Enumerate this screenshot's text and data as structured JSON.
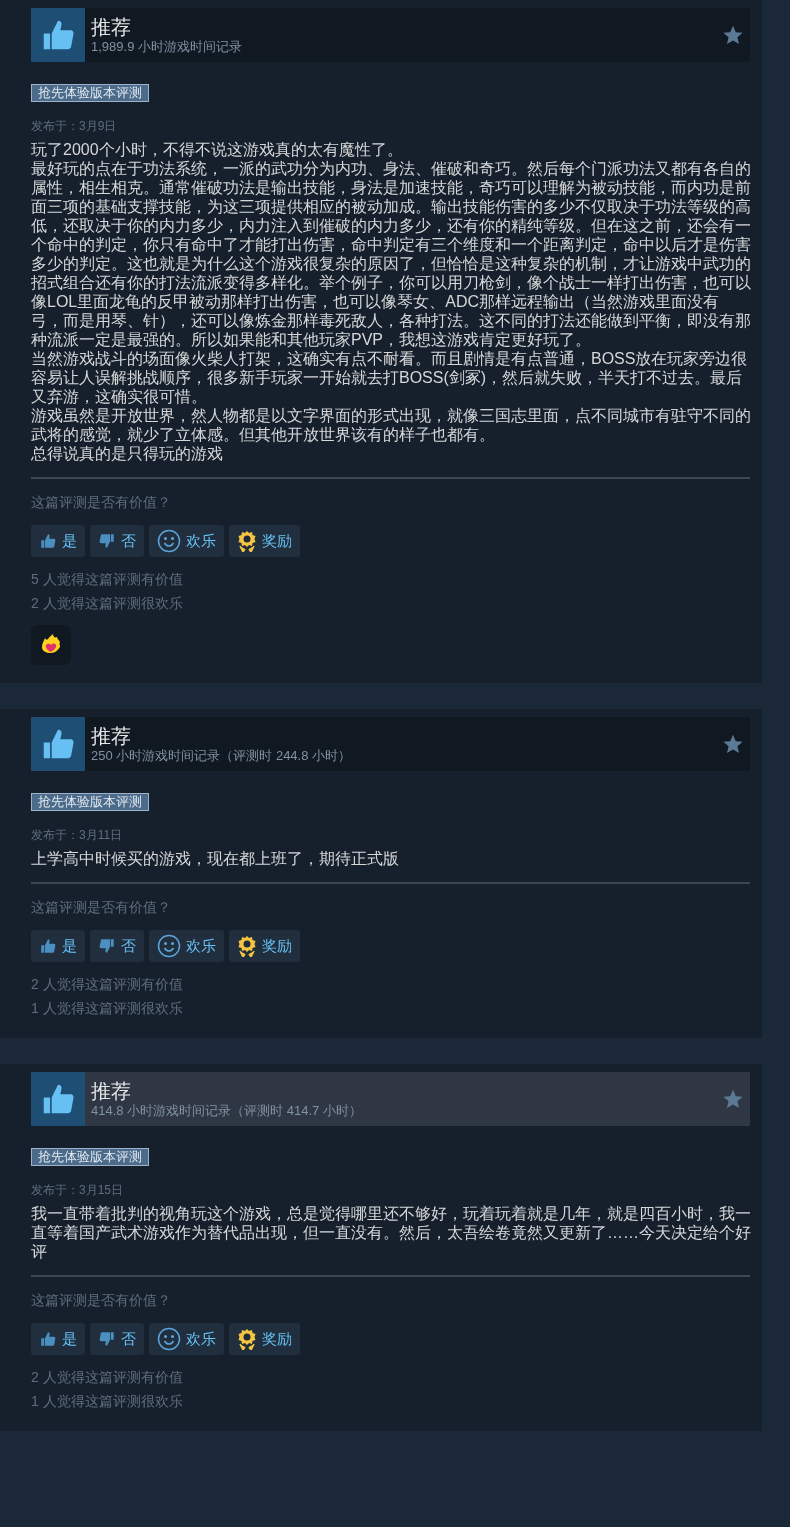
{
  "reviews": [
    {
      "recommendation": "推荐",
      "playtime": "1,989.9 小时游戏时间记录",
      "highlighted": false,
      "tag": "抢先体验版本评测",
      "date": "发布于：3月9日",
      "paragraphs": [
        "玩了2000个小时，不得不说这游戏真的太有魔性了。",
        "最好玩的点在于功法系统，一派的武功分为内功、身法、催破和奇巧。然后每个门派功法又都有各自的属性，相生相克。通常催破功法是输出技能，身法是加速技能，奇巧可以理解为被动技能，而内功是前面三项的基础支撑技能，为这三项提供相应的被动加成。输出技能伤害的多少不仅取决于功法等级的高低，还取决于你的内力多少，内力注入到催破的内力多少，还有你的精纯等级。但在这之前，还会有一个命中的判定，你只有命中了才能打出伤害，命中判定有三个维度和一个距离判定，命中以后才是伤害多少的判定。这也就是为什么这个游戏很复杂的原因了，但恰恰是这种复杂的机制，才让游戏中武功的招式组合还有你的打法流派变得多样化。举个例子，你可以用刀枪剑，像个战士一样打出伤害，也可以像LOL里面龙龟的反甲被动那样打出伤害，也可以像琴女、ADC那样远程输出（当然游戏里面没有弓，而是用琴、针），还可以像炼金那样毒死敌人，各种打法。这不同的打法还能做到平衡，即没有那种流派一定是最强的。所以如果能和其他玩家PVP，我想这游戏肯定更好玩了。",
        "当然游戏战斗的场面像火柴人打架，这确实有点不耐看。而且剧情是有点普通，BOSS放在玩家旁边很容易让人误解挑战顺序，很多新手玩家一开始就去打BOSS(剑冢)，然后就失败，半天打不过去。最后又弃游，这确实很可惜。",
        "游戏虽然是开放世界，然人物都是以文字界面的形式出现，就像三国志里面，点不同城市有驻守不同的武将的感觉，就少了立体感。但其他开放世界该有的样子也都有。",
        "总得说真的是只得玩的游戏"
      ],
      "question": "这篇评测是否有价值？",
      "buttons": [
        {
          "kind": "yes",
          "label": "是"
        },
        {
          "kind": "no",
          "label": "否"
        },
        {
          "kind": "funny",
          "label": "欢乐"
        },
        {
          "kind": "award",
          "label": "奖励"
        }
      ],
      "counts": [
        "5 人觉得这篇评测有价值",
        "2 人觉得这篇评测很欢乐"
      ],
      "award_badges": [
        {
          "kind": "flame-heart"
        }
      ]
    },
    {
      "recommendation": "推荐",
      "playtime": "250 小时游戏时间记录（评测时 244.8 小时）",
      "highlighted": false,
      "tag": "抢先体验版本评测",
      "date": "发布于：3月11日",
      "paragraphs": [
        "上学高中时候买的游戏，现在都上班了，期待正式版"
      ],
      "question": "这篇评测是否有价值？",
      "buttons": [
        {
          "kind": "yes",
          "label": "是"
        },
        {
          "kind": "no",
          "label": "否"
        },
        {
          "kind": "funny",
          "label": "欢乐"
        },
        {
          "kind": "award",
          "label": "奖励"
        }
      ],
      "counts": [
        "2 人觉得这篇评测有价值",
        "1 人觉得这篇评测很欢乐"
      ]
    },
    {
      "recommendation": "推荐",
      "playtime": "414.8 小时游戏时间记录（评测时 414.7 小时）",
      "highlighted": true,
      "tag": "抢先体验版本评测",
      "date": "发布于：3月15日",
      "paragraphs": [
        "我一直带着批判的视角玩这个游戏，总是觉得哪里还不够好，玩着玩着就是几年，就是四百小时，我一直等着国产武术游戏作为替代品出现，但一直没有。然后，太吾绘卷竟然又更新了……今天决定给个好评"
      ],
      "question": "这篇评测是否有价值？",
      "buttons": [
        {
          "kind": "yes",
          "label": "是"
        },
        {
          "kind": "no",
          "label": "否"
        },
        {
          "kind": "funny",
          "label": "欢乐"
        },
        {
          "kind": "award",
          "label": "奖励"
        }
      ],
      "counts": [
        "2 人觉得这篇评测有价值",
        "1 人觉得这篇评测很欢乐"
      ]
    }
  ]
}
